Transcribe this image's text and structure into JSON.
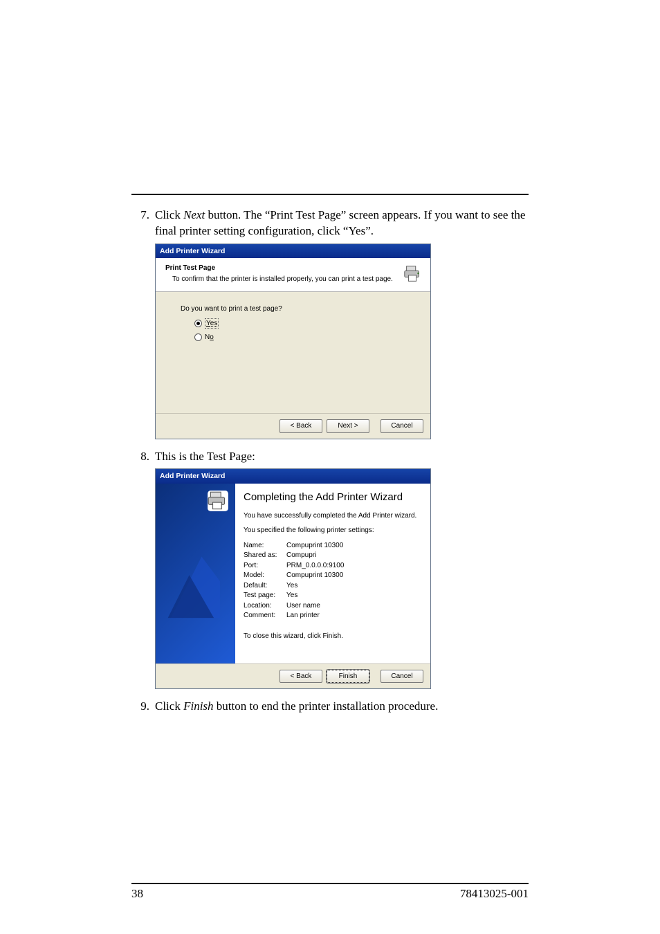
{
  "steps": {
    "s7_num": "7.",
    "s7_text_a": "Click ",
    "s7_text_em": "Next",
    "s7_text_b": " button. The “Print Test Page” screen appears. If you want to see the final printer setting configuration, click “Yes”.",
    "s8_num": "8.",
    "s8_text": "This is the Test Page:",
    "s9_num": "9.",
    "s9_text_a": "Click ",
    "s9_text_em": "Finish",
    "s9_text_b": " button to end the printer installation procedure."
  },
  "wiz1": {
    "window_title": "Add Printer Wizard",
    "header_title": "Print Test Page",
    "header_sub": "To confirm that the printer is installed properly, you can print a test page.",
    "prompt": "Do you want to print a test page?",
    "opt_yes_u": "Y",
    "opt_yes_rest": "es",
    "opt_no_u": "o",
    "opt_no_pre": "N",
    "btn_back": "< Back",
    "btn_next": "Next >",
    "btn_cancel": "Cancel"
  },
  "wiz2": {
    "window_title": "Add Printer Wizard",
    "title": "Completing the Add Printer Wizard",
    "line1": "You have successfully completed the Add Printer wizard.",
    "line2": "You specified the following printer settings:",
    "rows": [
      {
        "k": "Name:",
        "v": "Compuprint 10300"
      },
      {
        "k": "Shared as:",
        "v": "Compupri"
      },
      {
        "k": "Port:",
        "v": "PRM_0.0.0.0:9100"
      },
      {
        "k": "Model:",
        "v": "Compuprint 10300"
      },
      {
        "k": "Default:",
        "v": "Yes"
      },
      {
        "k": "Test page:",
        "v": "Yes"
      },
      {
        "k": "Location:",
        "v": "User name"
      },
      {
        "k": "Comment:",
        "v": "Lan printer"
      }
    ],
    "close_line": "To close this wizard, click Finish.",
    "btn_back": "< Back",
    "btn_finish": "Finish",
    "btn_cancel": "Cancel"
  },
  "footer": {
    "page": "38",
    "code": "78413025-001"
  }
}
